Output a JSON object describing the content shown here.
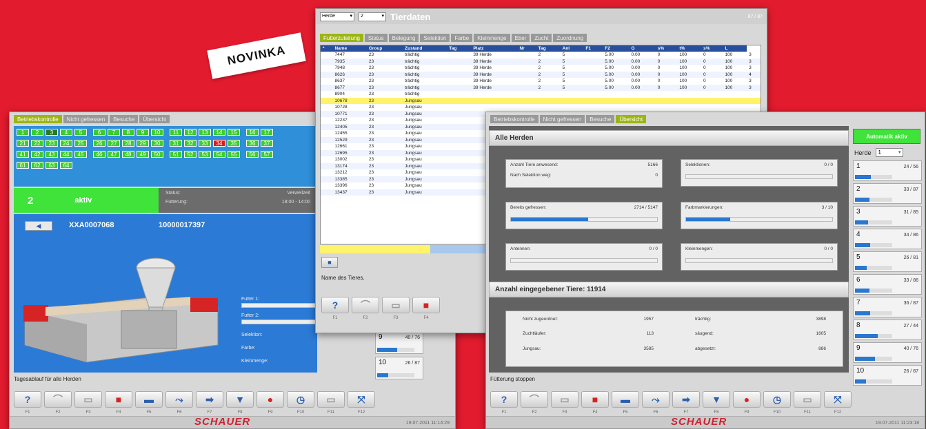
{
  "badge": "NOVINKA",
  "brand": "SCHAUER",
  "left": {
    "tabs": [
      "Betriebskontrolle",
      "Nicht gefressen",
      "Besuche",
      "Übersicht"
    ],
    "stations": [
      [
        "1",
        "2",
        "3",
        "4",
        "5",
        "6",
        "7",
        "8",
        "9",
        "10",
        "11",
        "12",
        "13",
        "14",
        "15",
        "16",
        "17"
      ],
      [
        "21",
        "22",
        "23",
        "24",
        "25",
        "26",
        "27",
        "28",
        "29",
        "30",
        "31",
        "32",
        "33",
        "34",
        "35",
        "36",
        "37"
      ],
      [
        "41",
        "42",
        "43",
        "44",
        "45",
        "46",
        "47",
        "48",
        "49",
        "50",
        "51",
        "52",
        "53",
        "54",
        "55",
        "56",
        "57"
      ],
      [
        "61",
        "62",
        "63",
        "64"
      ]
    ],
    "station_no": "2",
    "station_state": "aktiv",
    "status_label": "Status:",
    "status_value": "Verweilzeit",
    "ftime_label": "Fütterung:",
    "ftime_value": "18:00 - 14:00",
    "animal_id": "XXA0007068",
    "animal_num": "10000017397",
    "fields": [
      "Futter 1:",
      "Futter 2:",
      "Selektion:",
      "Farbe:",
      "Kleinmenge:"
    ],
    "herd9": "9",
    "herd9_val": "40 / 76",
    "herd10": "10",
    "herd10_val": "26 / 87",
    "status_text": "Tagesablauf für alle Herden",
    "datetime": "19.07.2011 11:14:29"
  },
  "middle": {
    "select_label": "Herde",
    "select_value": "2",
    "title": "Tierdaten",
    "counter": "87 / 87",
    "tabs": [
      "Futterzuteilung",
      "Status",
      "Belegung",
      "Selektion",
      "Farbe",
      "Kleinmenge",
      "Eber",
      "Zucht",
      "Zuordnung"
    ],
    "columns": [
      "Name",
      "Group",
      "Zustand",
      "Tag",
      "Platz",
      "Nr",
      "Tag",
      "Anl",
      "F1",
      "F2",
      "G",
      "s%",
      "t%",
      "s%",
      "L"
    ],
    "rows": [
      [
        "7447",
        "23",
        "trächtig",
        "",
        "39",
        "Herde",
        "",
        "2",
        "5",
        "",
        "5.00",
        "0.00",
        "0",
        "100",
        "0",
        "100",
        "3"
      ],
      [
        "7935",
        "23",
        "trächtig",
        "",
        "39",
        "Herde",
        "",
        "2",
        "5",
        "",
        "5.00",
        "0.00",
        "0",
        "100",
        "0",
        "100",
        "3"
      ],
      [
        "7948",
        "23",
        "trächtig",
        "",
        "39",
        "Herde",
        "",
        "2",
        "5",
        "",
        "5.00",
        "0.00",
        "0",
        "100",
        "0",
        "100",
        "3"
      ],
      [
        "8626",
        "23",
        "trächtig",
        "",
        "39",
        "Herde",
        "",
        "2",
        "5",
        "",
        "5.00",
        "0.00",
        "0",
        "100",
        "0",
        "100",
        "4"
      ],
      [
        "8637",
        "23",
        "trächtig",
        "",
        "39",
        "Herde",
        "",
        "2",
        "5",
        "",
        "5.00",
        "0.00",
        "0",
        "100",
        "0",
        "100",
        "3"
      ],
      [
        "8677",
        "23",
        "trächtig",
        "",
        "39",
        "Herde",
        "",
        "2",
        "5",
        "",
        "5.00",
        "0.00",
        "0",
        "100",
        "0",
        "100",
        "3"
      ],
      [
        "8904",
        "23",
        "trächtig",
        "",
        "",
        "",
        "",
        "",
        "",
        "",
        "",
        "",
        "",
        "",
        "",
        "",
        ""
      ],
      [
        "10678",
        "23",
        "Jungsau",
        "",
        "",
        "",
        "",
        "",
        "",
        "",
        "",
        "",
        "",
        "",
        "",
        "",
        ""
      ],
      [
        "10728",
        "23",
        "Jungsau",
        "",
        "",
        "",
        "",
        "",
        "",
        "",
        "",
        "",
        "",
        "",
        "",
        "",
        ""
      ],
      [
        "10771",
        "23",
        "Jungsau",
        "",
        "",
        "",
        "",
        "",
        "",
        "",
        "",
        "",
        "",
        "",
        "",
        "",
        ""
      ],
      [
        "12237",
        "23",
        "Jungsau",
        "",
        "",
        "",
        "",
        "",
        "",
        "",
        "",
        "",
        "",
        "",
        "",
        "",
        ""
      ],
      [
        "12405",
        "23",
        "Jungsau",
        "",
        "",
        "",
        "",
        "",
        "",
        "",
        "",
        "",
        "",
        "",
        "",
        "",
        ""
      ],
      [
        "12455",
        "23",
        "Jungsau",
        "",
        "",
        "",
        "",
        "",
        "",
        "",
        "",
        "",
        "",
        "",
        "",
        "",
        ""
      ],
      [
        "12529",
        "23",
        "Jungsau",
        "",
        "",
        "",
        "",
        "",
        "",
        "",
        "",
        "",
        "",
        "",
        "",
        "",
        ""
      ],
      [
        "12661",
        "23",
        "Jungsau",
        "",
        "",
        "",
        "",
        "",
        "",
        "",
        "",
        "",
        "",
        "",
        "",
        "",
        ""
      ],
      [
        "12695",
        "23",
        "Jungsau",
        "",
        "",
        "",
        "",
        "",
        "",
        "",
        "",
        "",
        "",
        "",
        "",
        "",
        ""
      ],
      [
        "13002",
        "23",
        "Jungsau",
        "",
        "",
        "",
        "",
        "",
        "",
        "",
        "",
        "",
        "",
        "",
        "",
        "",
        ""
      ],
      [
        "13174",
        "23",
        "Jungsau",
        "",
        "",
        "",
        "",
        "",
        "",
        "",
        "",
        "",
        "",
        "",
        "",
        "",
        ""
      ],
      [
        "13212",
        "23",
        "Jungsau",
        "",
        "",
        "",
        "",
        "",
        "",
        "",
        "",
        "",
        "",
        "",
        "",
        "",
        ""
      ],
      [
        "13385",
        "23",
        "Jungsau",
        "",
        "",
        "",
        "",
        "",
        "",
        "",
        "",
        "",
        "",
        "",
        "",
        "",
        ""
      ],
      [
        "13396",
        "23",
        "Jungsau",
        "",
        "",
        "",
        "",
        "",
        "",
        "",
        "",
        "",
        "",
        "",
        "",
        "",
        ""
      ],
      [
        "13437",
        "23",
        "Jungsau",
        "",
        "",
        "",
        "",
        "",
        "",
        "",
        "",
        "",
        "",
        "",
        "",
        "",
        ""
      ]
    ],
    "status_text": "Name des Tieres.",
    "fkeys": [
      "F1",
      "F2",
      "F3",
      "F4"
    ]
  },
  "right": {
    "tabs": [
      "Betriebskontrolle",
      "Nicht gefressen",
      "Besuche",
      "Übersicht"
    ],
    "auto_button": "Automatik aktiv",
    "herd_label": "Herde",
    "herd_value": "1",
    "section1": "Alle Herden",
    "stats": [
      {
        "label": "Anzahl Tiere anwesend:",
        "value": "5166",
        "label2": "Nach Selektion weg:",
        "value2": "0"
      },
      {
        "label": "Selektionen:",
        "value": "0 / 0"
      },
      {
        "label": "Bereits gefressen:",
        "value": "2714 / 5147",
        "pct": 0.53
      },
      {
        "label": "Farbmarkierungen:",
        "value": "3 / 10",
        "pct": 0.3
      },
      {
        "label": "Antennen:",
        "value": "0 / 0",
        "pct": 0
      },
      {
        "label": "Kleinmengen:",
        "value": "0 / 0",
        "pct": 0
      }
    ],
    "section2": "Anzahl eingegebener Tiere: 11914",
    "counts": [
      {
        "label": "Nicht zugeordnet:",
        "value": "1957"
      },
      {
        "label": "Zuchtläufer:",
        "value": "113"
      },
      {
        "label": "Jungsau:",
        "value": "3585"
      },
      {
        "label": "trächtig:",
        "value": "3898"
      },
      {
        "label": "säugend:",
        "value": "1605"
      },
      {
        "label": "abgesetzt:",
        "value": "886"
      }
    ],
    "herds": [
      {
        "n": "1",
        "v": "24 / 56",
        "p": 0.43
      },
      {
        "n": "2",
        "v": "33 / 87",
        "p": 0.38
      },
      {
        "n": "3",
        "v": "31 / 85",
        "p": 0.36
      },
      {
        "n": "4",
        "v": "34 / 86",
        "p": 0.4
      },
      {
        "n": "5",
        "v": "26 / 81",
        "p": 0.32
      },
      {
        "n": "6",
        "v": "33 / 86",
        "p": 0.38
      },
      {
        "n": "7",
        "v": "36 / 87",
        "p": 0.41
      },
      {
        "n": "8",
        "v": "27 / 44",
        "p": 0.61
      },
      {
        "n": "9",
        "v": "40 / 76",
        "p": 0.53
      },
      {
        "n": "10",
        "v": "26 / 87",
        "p": 0.3
      }
    ],
    "status_text": "Fütterung stoppen",
    "datetime": "19.07.2011 11:23:18"
  },
  "fkeys": [
    "F1",
    "F2",
    "F3",
    "F4",
    "F5",
    "F6",
    "F7",
    "F8",
    "F9",
    "F10",
    "F11",
    "F12"
  ]
}
